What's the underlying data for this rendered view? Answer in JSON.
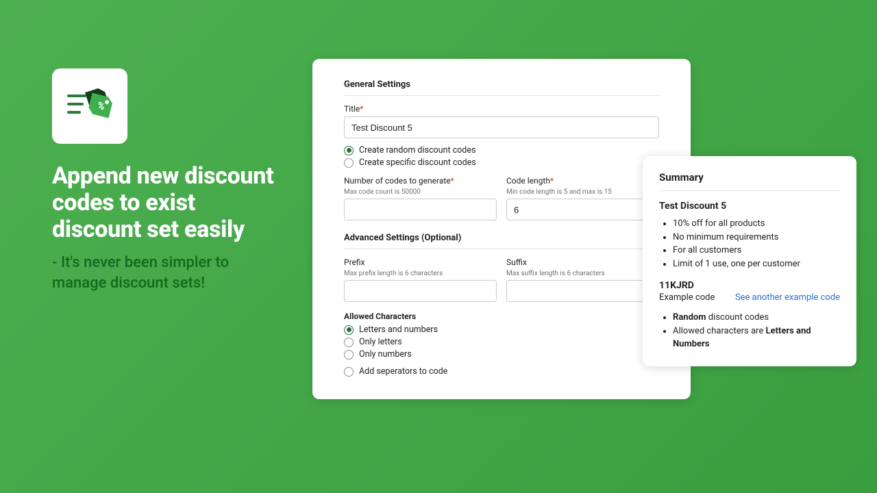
{
  "hero": {
    "headline": "Append new discount codes to exist discount set easily",
    "subhead": "- It's never been simpler to manage  discount sets!"
  },
  "form": {
    "general_title": "General Settings",
    "title_label": "Title",
    "title_value": "Test Discount 5",
    "radio_random": "Create random discount codes",
    "radio_specific": "Create specific discount codes",
    "count_label": "Number of codes to generate",
    "count_hint": "Max code count is 50000",
    "count_value": "",
    "length_label": "Code length",
    "length_hint": "Min code length is 5 and max is 15",
    "length_value": "6",
    "advanced_title": "Advanced Settings (Optional)",
    "prefix_label": "Prefix",
    "prefix_hint": "Max prefix length is 6 characters",
    "prefix_value": "",
    "suffix_label": "Suffix",
    "suffix_hint": "Max suffix length is 6 characters",
    "suffix_value": "",
    "allowed_title": "Allowed Characters",
    "chars_both": "Letters and numbers",
    "chars_letters": "Only letters",
    "chars_numbers": "Only numbers",
    "separators": "Add seperators to code"
  },
  "summary": {
    "title": "Summary",
    "name": "Test Discount 5",
    "items": [
      "10% off for all products",
      "No minimum requirements",
      "For all customers",
      "Limit of 1 use, one per customer"
    ],
    "code": "11KJRD",
    "example_label": "Example code",
    "see_another": "See another example code",
    "random_word": "Random",
    "random_rest": " discount codes",
    "allowed_prefix": "Allowed characters are ",
    "allowed_bold": "Letters and Numbers"
  }
}
